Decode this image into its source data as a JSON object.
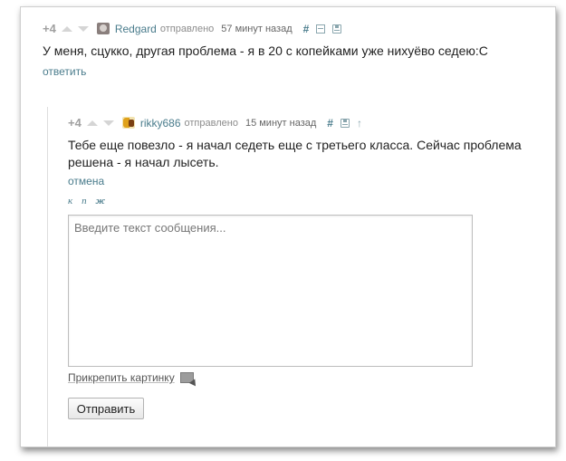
{
  "comment1": {
    "rating": "+4",
    "username": "Redgard",
    "posted_label": "отправлено",
    "time": "57 минут назад",
    "hash": "#",
    "text": "У меня, сцукко, другая проблема - я в 20 с копейками уже нихуёво седею:С",
    "reply_link": "ответить",
    "icons": [
      "thumbs-up",
      "thumbs-down",
      "collapse",
      "save"
    ]
  },
  "comment2": {
    "rating": "+4",
    "username": "rikky686",
    "posted_label": "отправлено",
    "time": "15 минут назад",
    "hash": "#",
    "up_arrow": "↑",
    "text_line1": "Тебе еще повезло - я начал седеть еще с третьего класса. Сейчас проблема",
    "text_line2": "решена - я начал лысеть.",
    "cancel_link": "отмена"
  },
  "reply_form": {
    "format_buttons": [
      "к",
      "п",
      "ж"
    ],
    "textarea_placeholder": "Введите текст сообщения...",
    "textarea_value": "",
    "attach_label": "Прикрепить картинку",
    "submit_label": "Отправить"
  },
  "colors": {
    "link": "#4a7c8c",
    "text": "#222222",
    "muted": "#8c8c8c"
  }
}
